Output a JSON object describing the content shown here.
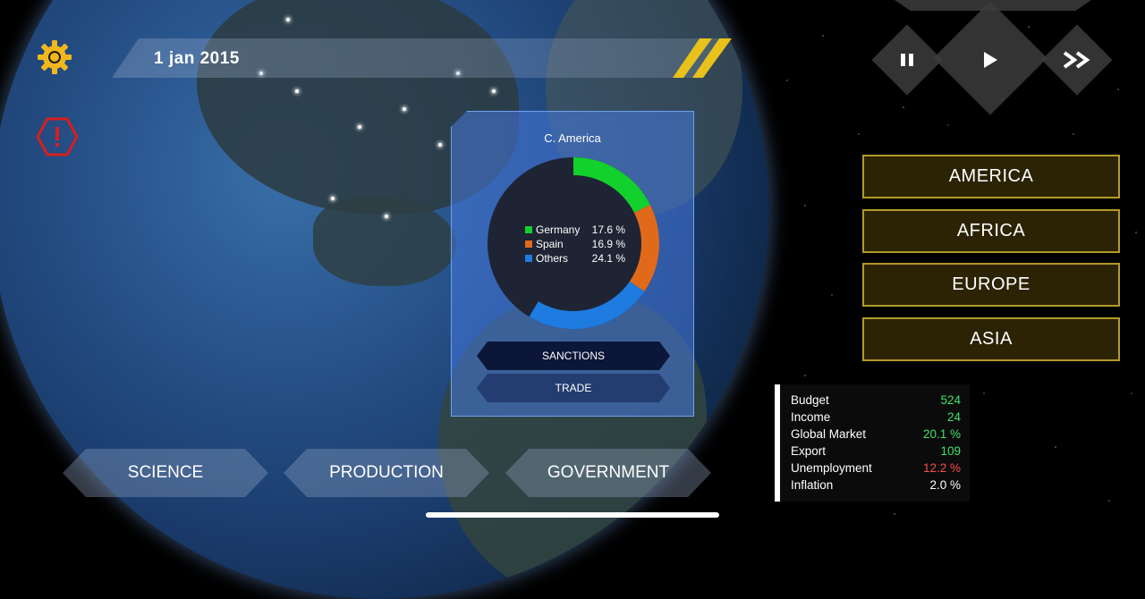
{
  "date": "1 jan 2015",
  "icons": {
    "settings": "gear-icon",
    "alert": "alert-icon",
    "pause": "pause-icon",
    "play": "play-icon",
    "fast_forward": "fast-forward-icon"
  },
  "colors": {
    "gear": "#f0b81c",
    "alert": "#d81e1e",
    "region_border": "#b39a2a",
    "germany": "#12d12c",
    "spain": "#e06a1a",
    "others": "#1e7be0",
    "stat_green": "#3ee36a",
    "stat_red": "#ff4b4b"
  },
  "regions": [
    "AMERICA",
    "AFRICA",
    "EUROPE",
    "ASIA"
  ],
  "stats": [
    {
      "label": "Budget",
      "value": "524",
      "color": "green"
    },
    {
      "label": "Income",
      "value": "24",
      "color": "green"
    },
    {
      "label": "Global Market",
      "value": "20.1 %",
      "color": "green"
    },
    {
      "label": "Export",
      "value": "109",
      "color": "green"
    },
    {
      "label": "Unemployment",
      "value": "12.2 %",
      "color": "red"
    },
    {
      "label": "Inflation",
      "value": "2.0 %",
      "color": "white"
    }
  ],
  "panel": {
    "title": "C. America",
    "sanctions_label": "SANCTIONS",
    "trade_label": "TRADE"
  },
  "chart_data": {
    "type": "pie",
    "title": "C. America",
    "categories": [
      "Germany",
      "Spain",
      "Others"
    ],
    "values": [
      17.6,
      16.9,
      24.1
    ],
    "labels": [
      "17.6 %",
      "16.9 %",
      "24.1 %"
    ],
    "colors": [
      "#12d12c",
      "#e06a1a",
      "#1e7be0"
    ],
    "legend": "center"
  },
  "bottom_menu": [
    "SCIENCE",
    "PRODUCTION",
    "GOVERNMENT"
  ]
}
